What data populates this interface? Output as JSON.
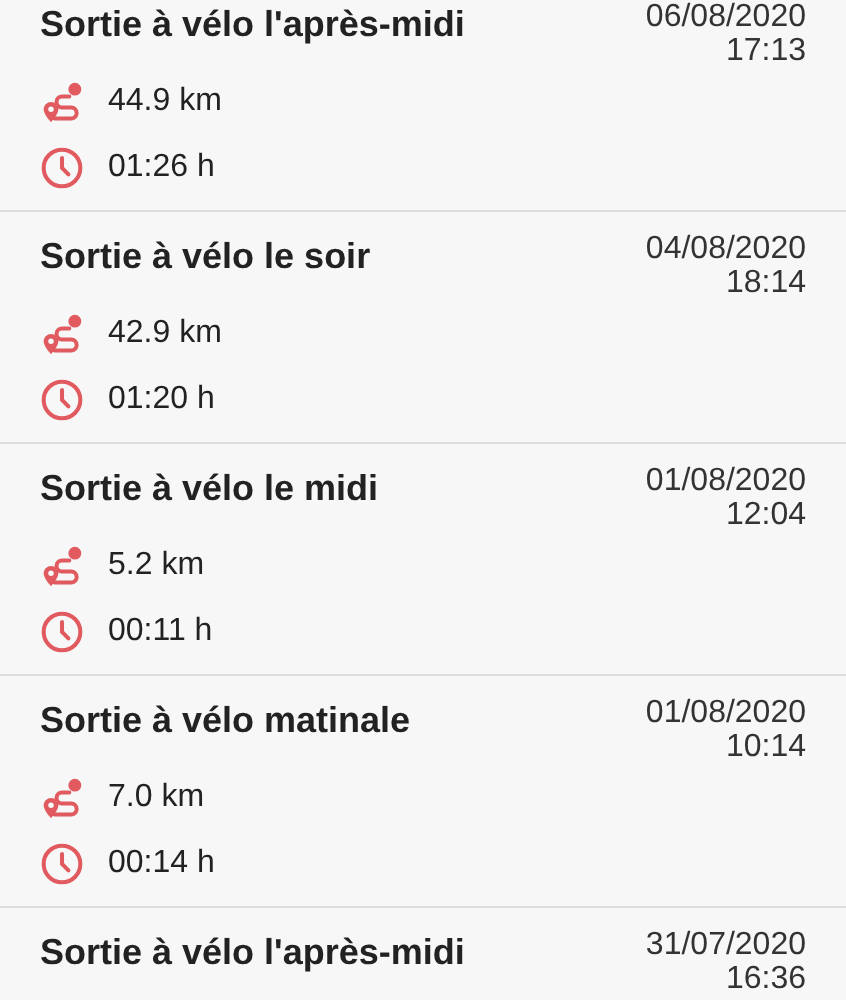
{
  "rides": [
    {
      "title": "Sortie à vélo l'après-midi",
      "date": "06/08/2020",
      "time": "17:13",
      "distance": "44.9 km",
      "duration": "01:26 h"
    },
    {
      "title": "Sortie à vélo le soir",
      "date": "04/08/2020",
      "time": "18:14",
      "distance": "42.9 km",
      "duration": "01:20 h"
    },
    {
      "title": "Sortie à vélo le midi",
      "date": "01/08/2020",
      "time": "12:04",
      "distance": "5.2 km",
      "duration": "00:11 h"
    },
    {
      "title": "Sortie à vélo matinale",
      "date": "01/08/2020",
      "time": "10:14",
      "distance": "7.0 km",
      "duration": "00:14 h"
    },
    {
      "title": "Sortie à vélo l'après-midi",
      "date": "31/07/2020",
      "time": "16:36"
    }
  ]
}
